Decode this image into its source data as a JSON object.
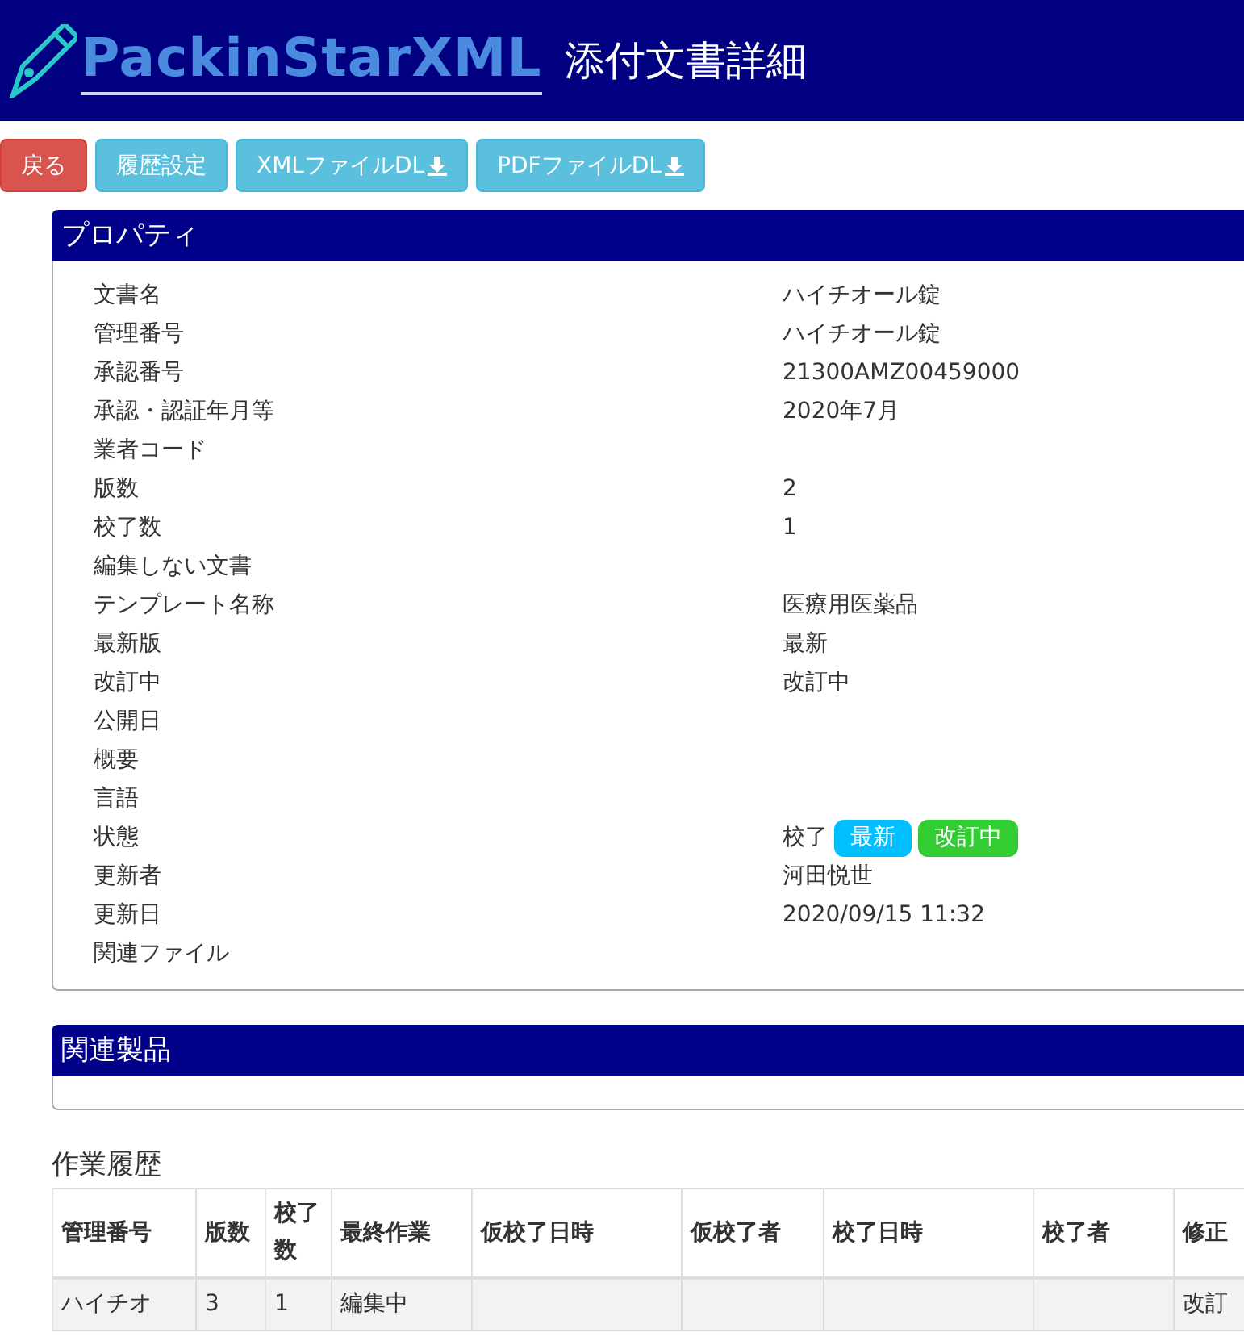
{
  "header": {
    "logo": "PackinStarXML",
    "title": "添付文書詳細"
  },
  "buttons": [
    {
      "label": "戻る",
      "kind": "danger"
    },
    {
      "label": "履歴設定",
      "kind": "info"
    },
    {
      "label": "XMLファイルDL",
      "kind": "download"
    },
    {
      "label": "PDFファイルDL",
      "kind": "download"
    }
  ],
  "properties": {
    "title": "プロパティ",
    "rows": [
      {
        "label": "文書名",
        "value": "ハイチオール錠"
      },
      {
        "label": "管理番号",
        "value": "ハイチオール錠"
      },
      {
        "label": "承認番号",
        "value": "21300AMZ00459000"
      },
      {
        "label": "承認・認証年月等",
        "value": "2020年7月"
      },
      {
        "label": "業者コード"
      },
      {
        "label": "版数",
        "value": "2"
      },
      {
        "label": "校了数",
        "value": "1"
      },
      {
        "label": "編集しない文書"
      },
      {
        "label": "テンプレート名称",
        "value": "医療用医薬品"
      },
      {
        "label": "最新版",
        "value": "最新"
      },
      {
        "label": "改訂中",
        "value": "改訂中"
      },
      {
        "label": "公開日"
      },
      {
        "label": "概要"
      },
      {
        "label": "言語"
      },
      {
        "label": "状態",
        "value": "校了",
        "badges": [
          {
            "label": "最新",
            "color": "#00bfff"
          },
          {
            "label": "改訂中",
            "color": "#33cc33"
          }
        ]
      },
      {
        "label": "更新者",
        "value": "河田悦世"
      },
      {
        "label": "更新日",
        "value": "2020/09/15 11:32"
      },
      {
        "label": "関連ファイル"
      }
    ]
  },
  "related_products": {
    "title": "関連製品"
  },
  "history": {
    "title": "作業履歴",
    "columns": [
      "管理番号",
      "版数",
      "校了数",
      "最終作業",
      "仮校了日時",
      "仮校了者",
      "校了日時",
      "校了者",
      "修正"
    ],
    "rows": [
      {
        "column_1": "ハイチオ",
        "column_2": "3",
        "column_3": "1",
        "column_4": "編集中",
        "column_9": "改訂"
      }
    ]
  }
}
